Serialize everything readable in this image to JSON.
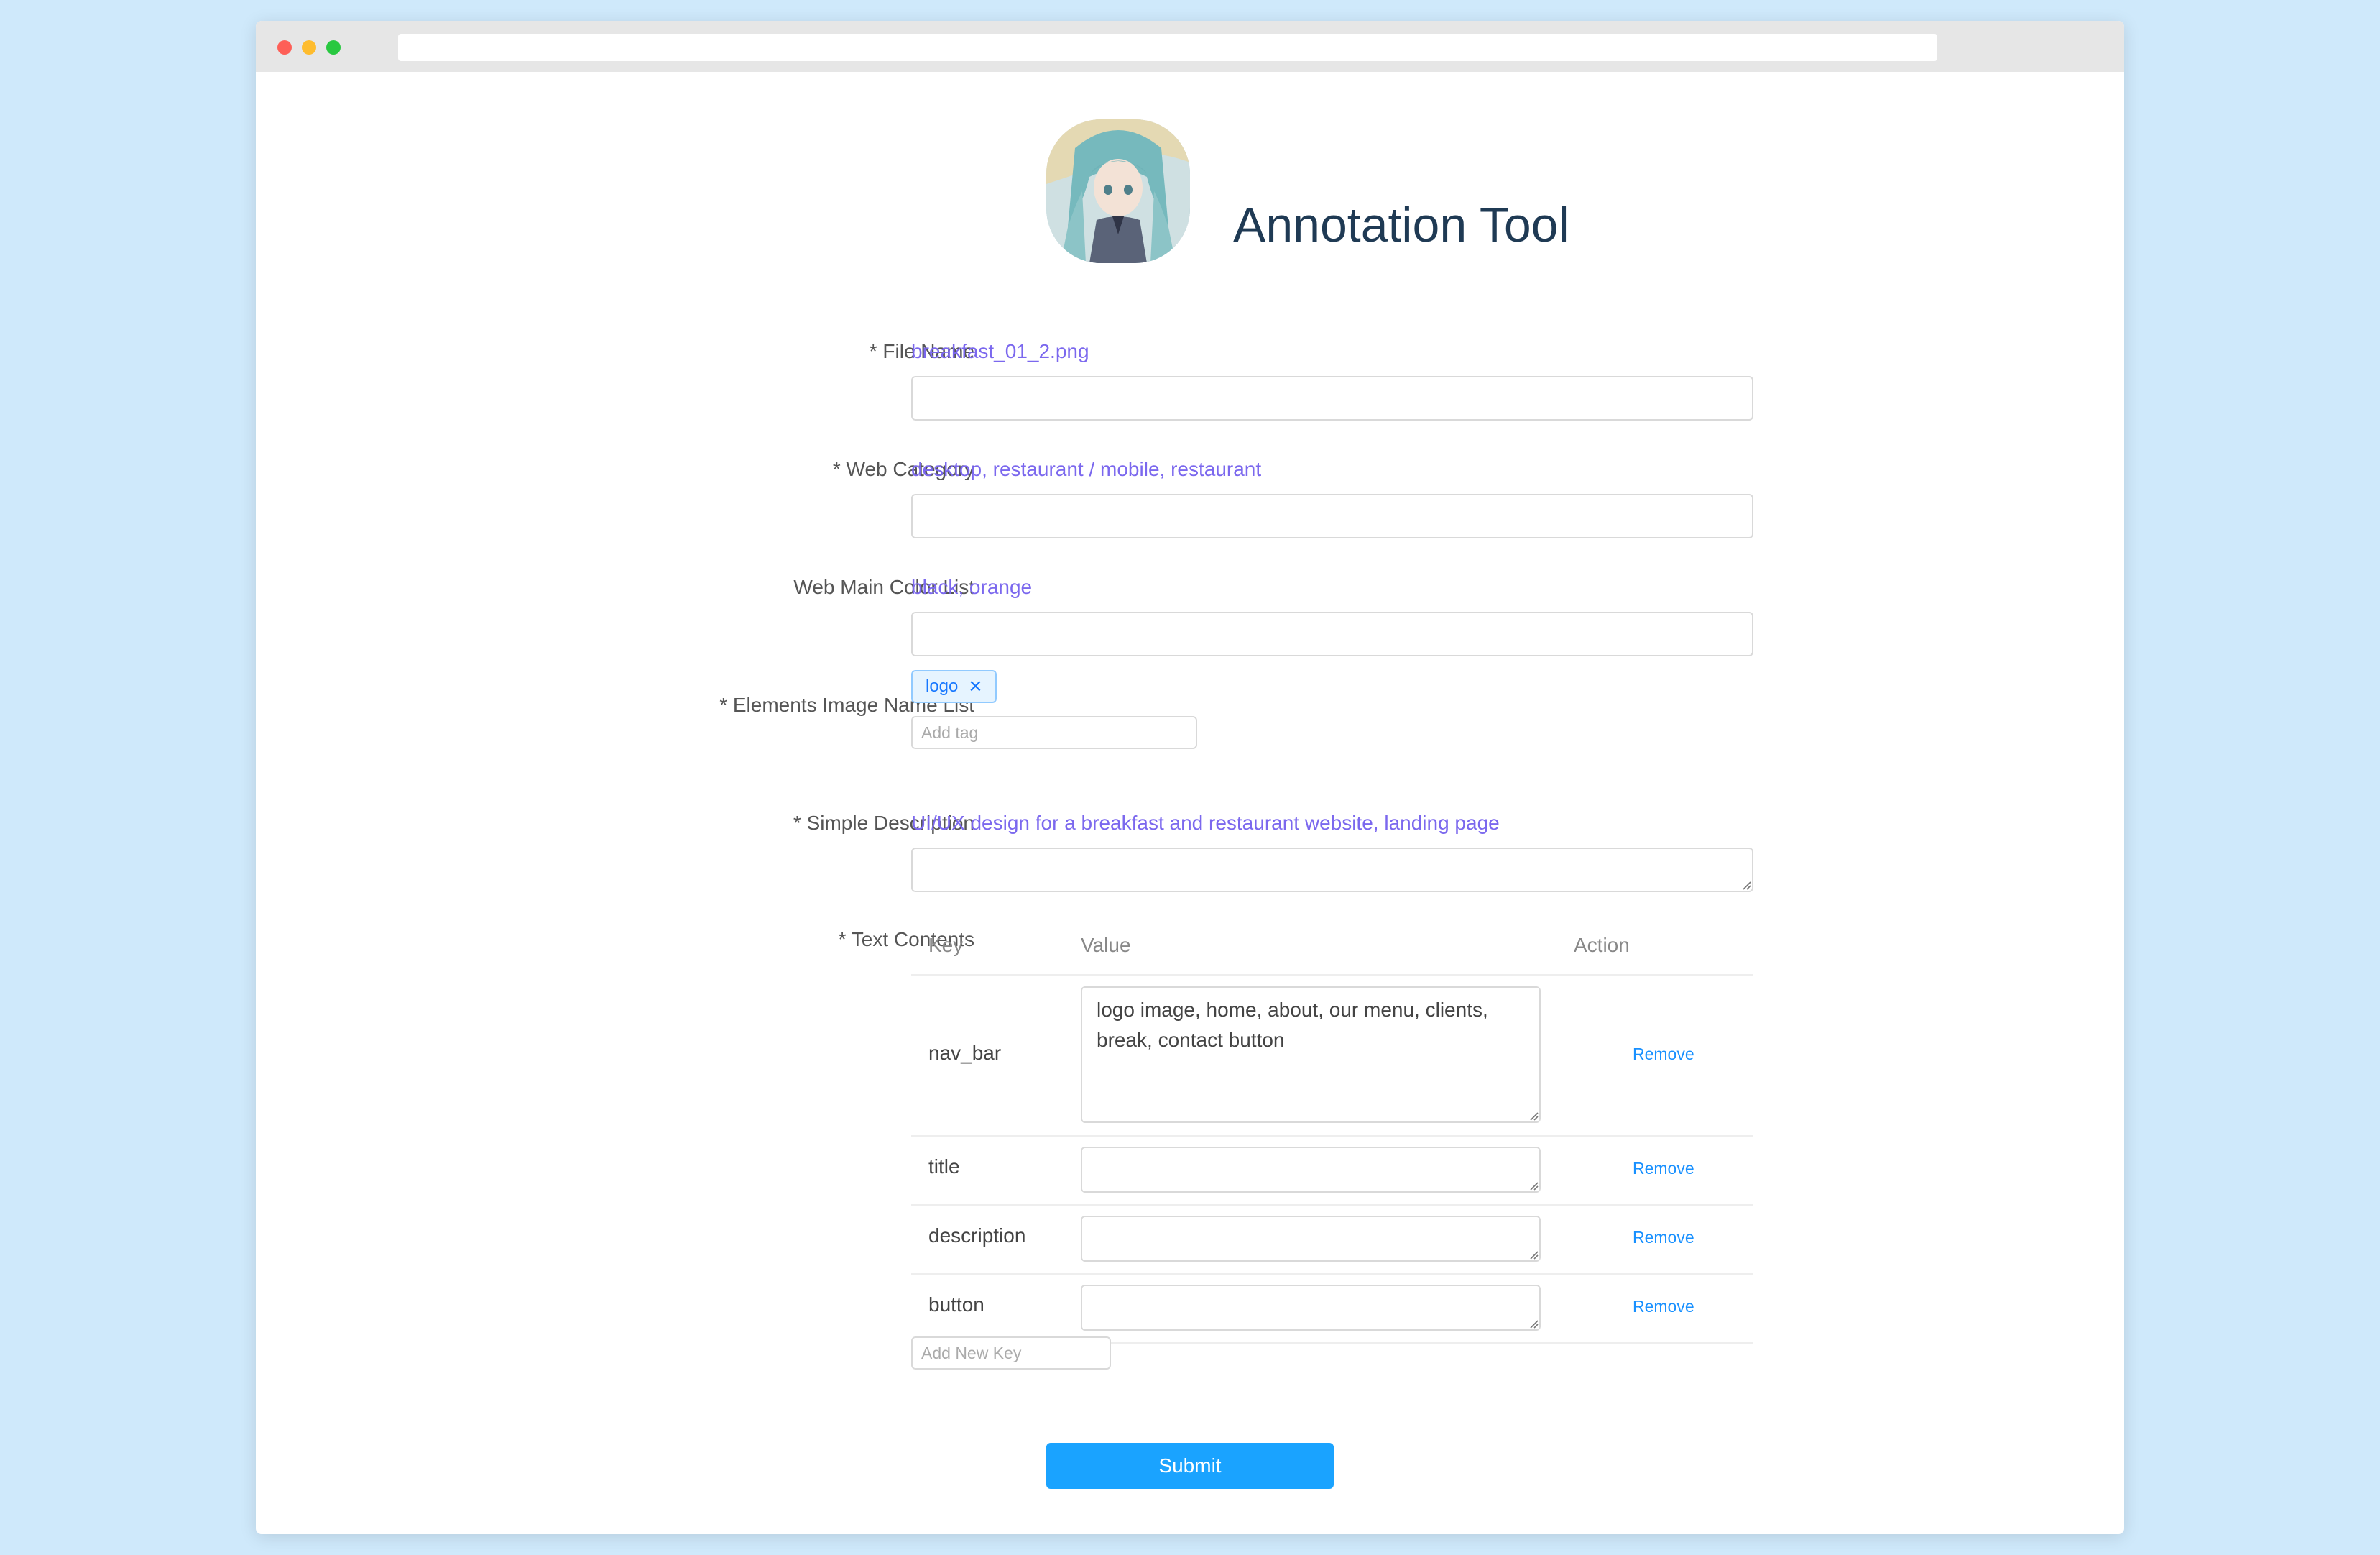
{
  "app": {
    "title": "Annotation Tool",
    "logo_icon": "avatar-illustration-icon"
  },
  "form": {
    "file_name": {
      "label": "* File Name",
      "hint": "breakfast_01_2.png",
      "value": ""
    },
    "web_category": {
      "label": "* Web Category",
      "hint": "desktop, restaurant / mobile, restaurant",
      "value": ""
    },
    "web_main_color_list": {
      "label": "Web Main Color List",
      "hint": "black, orange",
      "value": ""
    },
    "elements_image_name_list": {
      "label": "* Elements Image Name List",
      "tags": [
        "logo"
      ],
      "tag_close_icon": "close-icon",
      "add_placeholder": "Add tag"
    },
    "simple_description": {
      "label": "* Simple Description",
      "hint": "UI/UX design for a breakfast and restaurant website, landing page",
      "value": ""
    },
    "text_contents": {
      "label": "* Text Contents",
      "columns": {
        "key": "Key",
        "value": "Value",
        "action": "Action"
      },
      "rows": [
        {
          "key": "nav_bar",
          "value": "logo image, home, about, our menu, clients, break, contact button",
          "action": "Remove"
        },
        {
          "key": "title",
          "value": "",
          "action": "Remove"
        },
        {
          "key": "description",
          "value": "",
          "action": "Remove"
        },
        {
          "key": "button",
          "value": "",
          "action": "Remove"
        }
      ],
      "add_key_placeholder": "Add New Key"
    },
    "submit_label": "Submit"
  },
  "colors": {
    "background": "#cfe9fb",
    "hint": "#7b68ee",
    "link": "#1890ff",
    "primary_button": "#1aa3ff",
    "title": "#1f3a54"
  }
}
